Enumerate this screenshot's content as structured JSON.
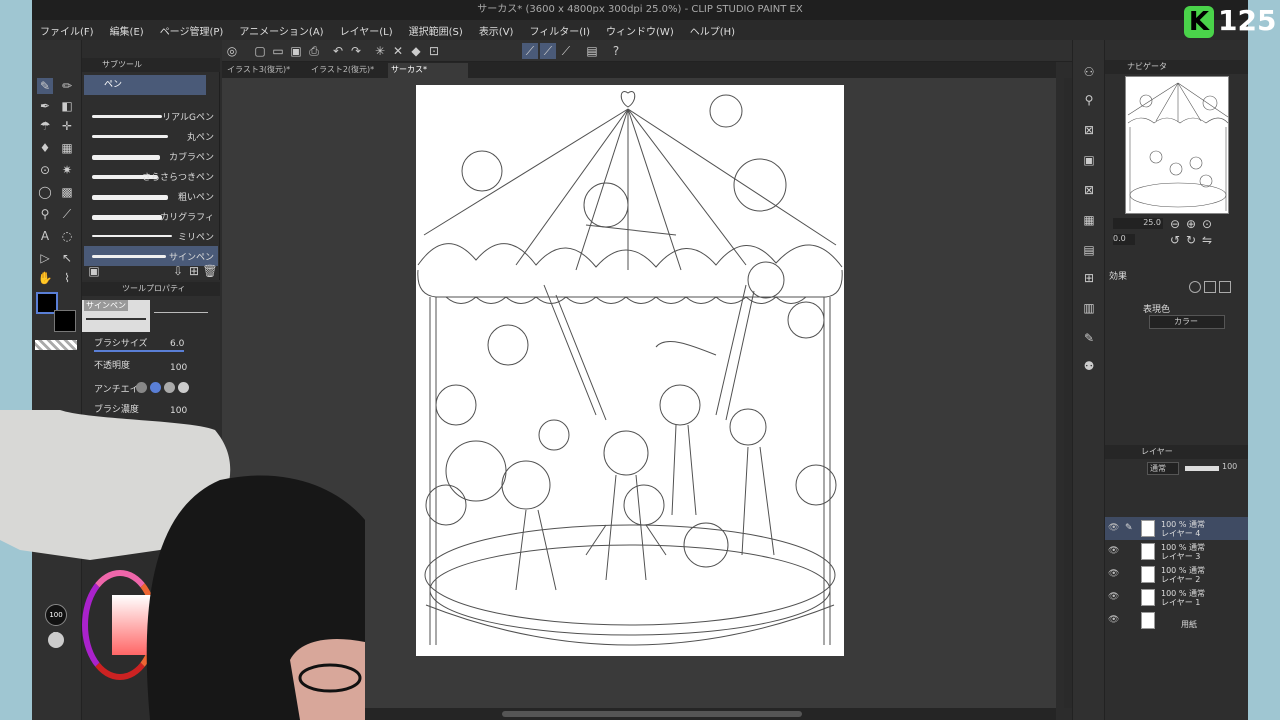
{
  "window": {
    "title": "サーカス* (3600 x 4800px 300dpi 25.0%)  - CLIP STUDIO PAINT EX"
  },
  "menu": [
    "ファイル(F)",
    "編集(E)",
    "ページ管理(P)",
    "アニメーション(A)",
    "レイヤー(L)",
    "選択範囲(S)",
    "表示(V)",
    "フィルター(I)",
    "ウィンドウ(W)",
    "ヘルプ(H)"
  ],
  "subtool": {
    "header": "サブツール",
    "group": "ペン",
    "brushes": [
      "リアルGペン",
      "丸ペン",
      "カブラペン",
      "さらさらつきペン",
      "粗いペン",
      "カリグラフィ",
      "ミリペン",
      "サインペン"
    ]
  },
  "tool_property": {
    "header": "ツールプロパティ",
    "brush_name": "サインペン",
    "size_label": "ブラシサイズ",
    "size_value": "6.0",
    "opacity_label": "不透明度",
    "opacity_value": "100",
    "antialias_label": "アンチエイリ",
    "density_label": "ブラシ濃度",
    "density_value": "100"
  },
  "tabs": [
    "イラスト3(復元)*",
    "イラスト2(復元)*",
    "サーカス*"
  ],
  "navigator": {
    "header": "ナビゲータ",
    "zoom": "25.0",
    "rotation": "0.0"
  },
  "effect": {
    "header": "効果",
    "color_label": "表現色",
    "color_value": "カラー"
  },
  "layers": {
    "header": "レイヤー",
    "blend_mode": "通常",
    "opacity": "100",
    "items": [
      {
        "mode": "100 % 通常",
        "name": "レイヤー 4"
      },
      {
        "mode": "100 % 通常",
        "name": "レイヤー 3"
      },
      {
        "mode": "100 % 通常",
        "name": "レイヤー 2"
      },
      {
        "mode": "100 % 通常",
        "name": "レイヤー 1"
      },
      {
        "mode": "",
        "name": "用紙"
      }
    ]
  },
  "color_slider": {
    "opacity": "100 %"
  },
  "badge": {
    "count": "125",
    "letter": "K"
  },
  "status": {
    "zoom_field": "0"
  },
  "colors": {
    "accent": "#5a7fd6",
    "panel": "#2e2e2e",
    "badge_green": "#4ad34a"
  }
}
